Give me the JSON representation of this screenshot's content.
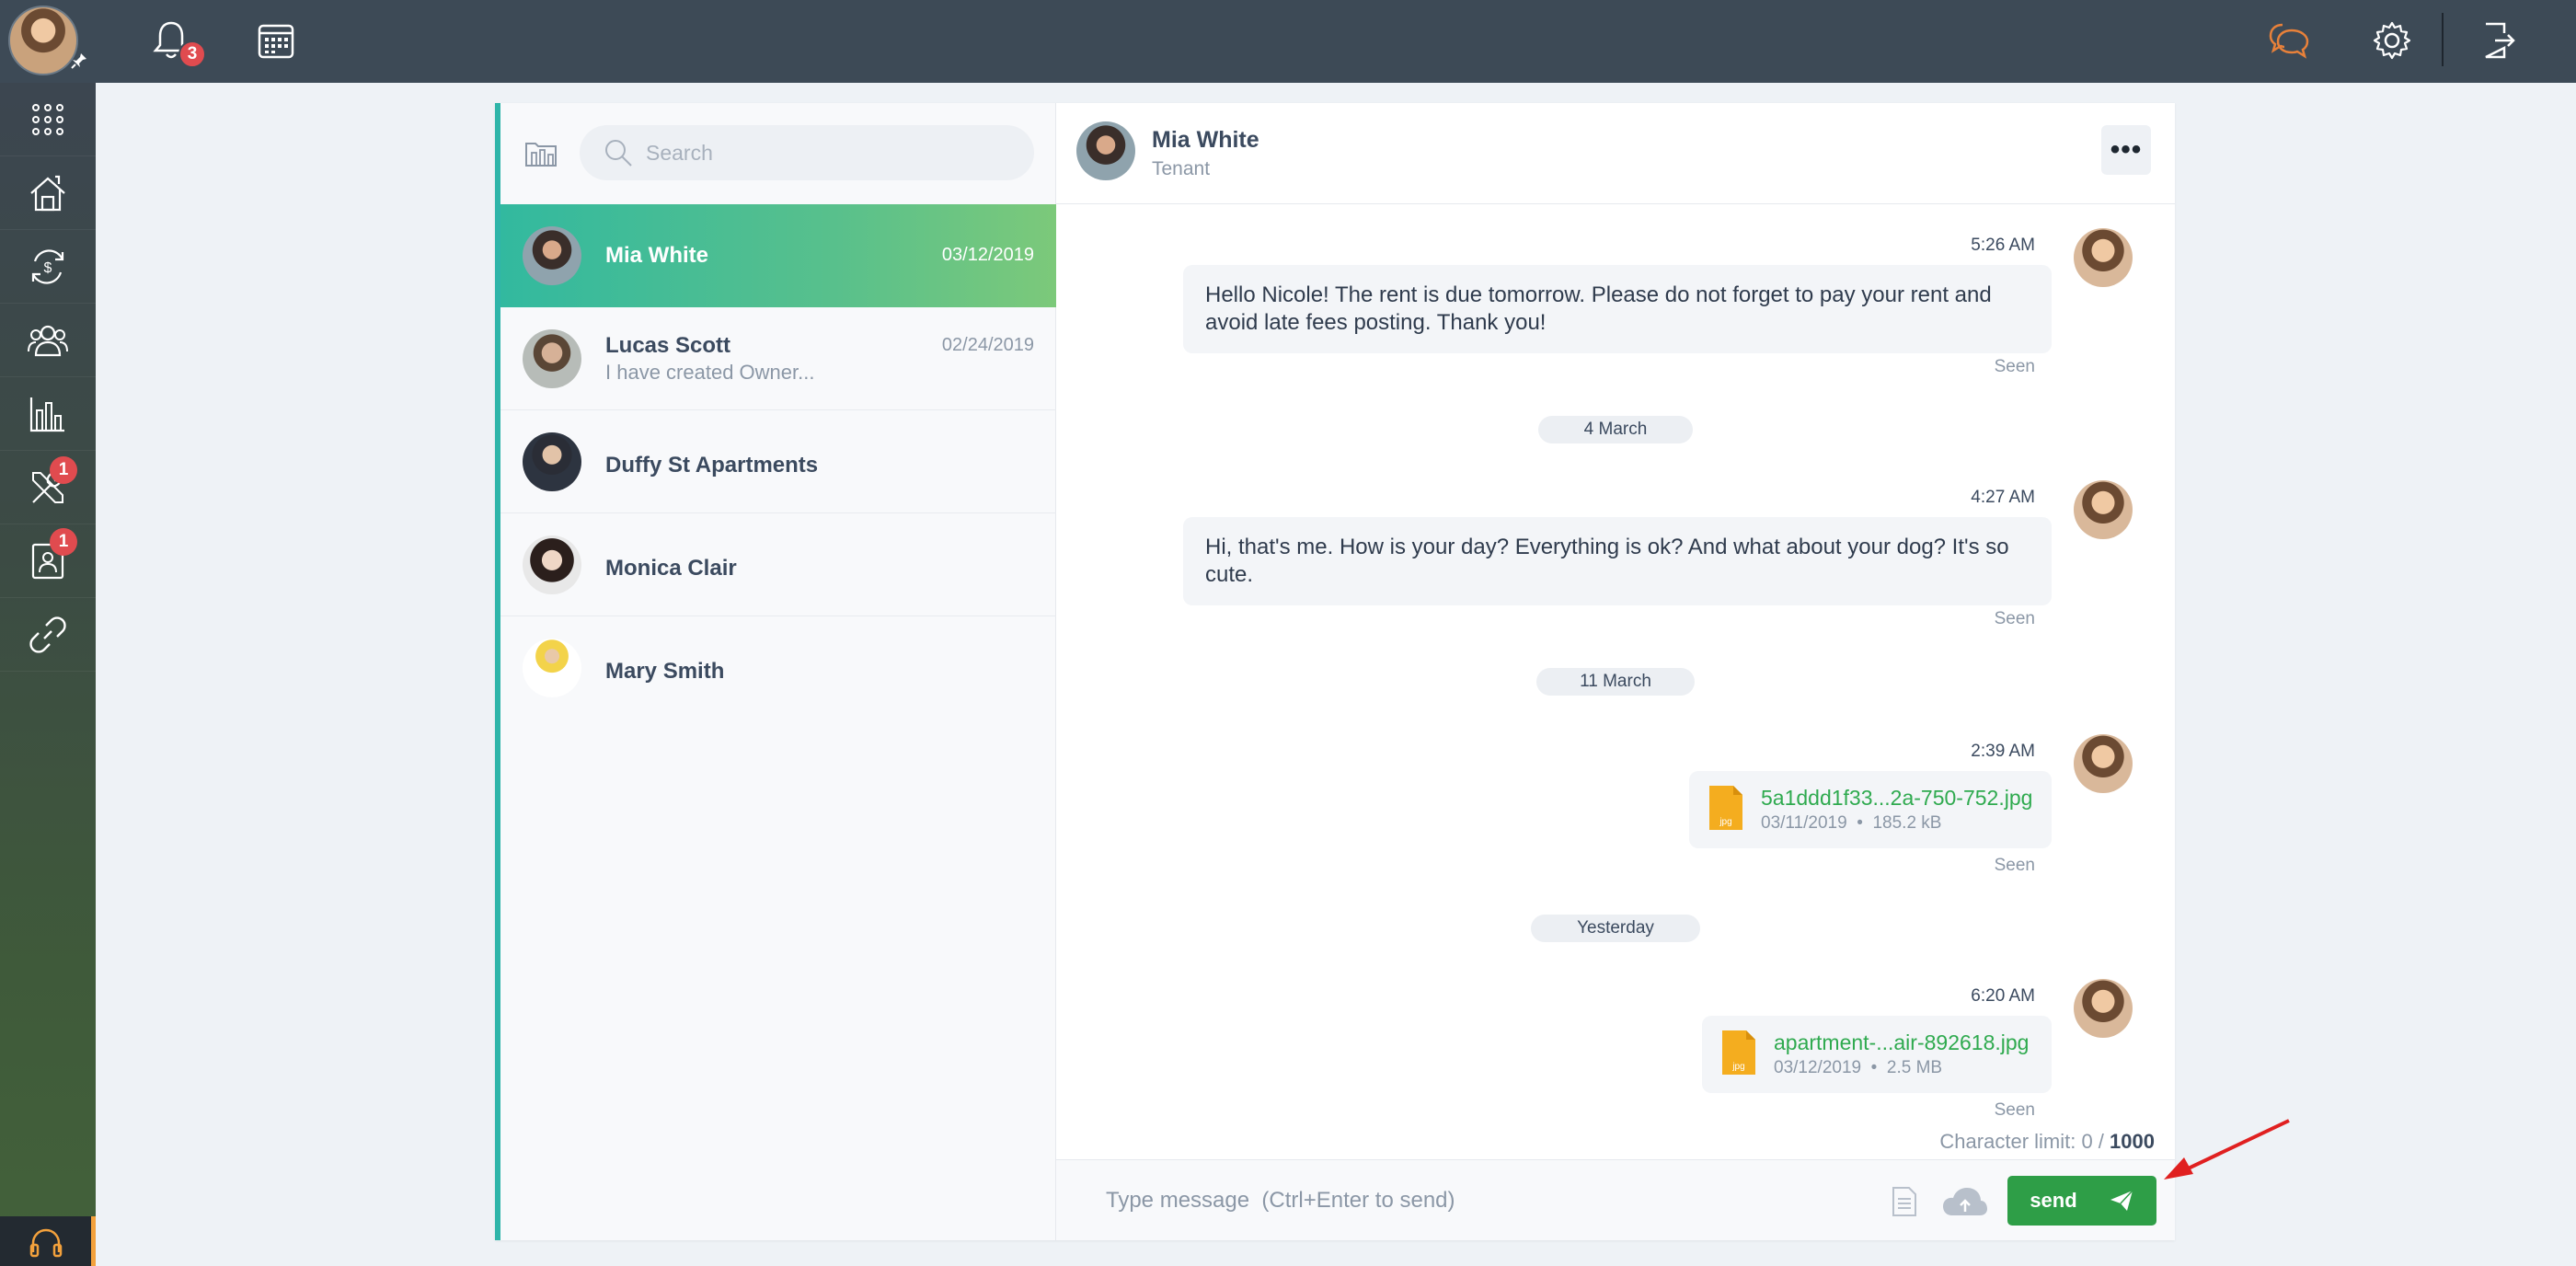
{
  "topbar": {
    "notifications_count": "3",
    "icons": [
      "bell-icon",
      "calendar-icon",
      "chat-icon",
      "gear-icon",
      "logout-icon"
    ],
    "accent_chat_color": "#e8813a"
  },
  "sidebar": {
    "items": [
      {
        "icon": "apps-grid-icon"
      },
      {
        "icon": "properties-icon"
      },
      {
        "icon": "accounting-icon"
      },
      {
        "icon": "people-icon"
      },
      {
        "icon": "reports-icon"
      },
      {
        "icon": "maintenance-icon",
        "badge": "1"
      },
      {
        "icon": "applications-icon",
        "badge": "1"
      },
      {
        "icon": "link-icon"
      }
    ],
    "support_icon": "headset-icon"
  },
  "search": {
    "placeholder": "Search"
  },
  "conversations": [
    {
      "name": "Mia White",
      "date": "03/12/2019",
      "preview": "",
      "active": true
    },
    {
      "name": "Lucas Scott",
      "date": "02/24/2019",
      "preview": "I have created Owner...",
      "active": false
    },
    {
      "name": "Duffy St Apartments",
      "date": "",
      "preview": "",
      "active": false
    },
    {
      "name": "Monica Clair",
      "date": "",
      "preview": "",
      "active": false
    },
    {
      "name": "Mary Smith",
      "date": "",
      "preview": "",
      "active": false
    }
  ],
  "chat": {
    "contact_name": "Mia White",
    "contact_role": "Tenant",
    "more_label": "•••",
    "messages": [
      {
        "time": "5:26 AM",
        "text": "Hello Nicole! The rent is due tomorrow. Please do not forget to pay your rent and avoid late fees posting. Thank you!",
        "status": "Seen"
      },
      {
        "divider": "4 March"
      },
      {
        "time": "4:27 AM",
        "text": "Hi, that's me. How is your day? Everything is ok? And what about your dog? It's so cute.",
        "status": "Seen"
      },
      {
        "divider": "11 March"
      },
      {
        "time": "2:39 AM",
        "file_name": "5a1ddd1f33...2a-750-752.jpg",
        "file_ext": "jpg",
        "file_date": "03/11/2019",
        "file_size": "185.2 kB",
        "status": "Seen"
      },
      {
        "divider": "Yesterday"
      },
      {
        "time": "6:20 AM",
        "file_name": "apartment-...air-892618.jpg",
        "file_ext": "jpg",
        "file_date": "03/12/2019",
        "file_size": "2.5 MB",
        "status": "Seen"
      }
    ],
    "char_limit_label": "Character limit: 0 /",
    "char_limit_max": "1000",
    "composer_placeholder": "Type message  (Ctrl+Enter to send)",
    "send_label": "send"
  }
}
